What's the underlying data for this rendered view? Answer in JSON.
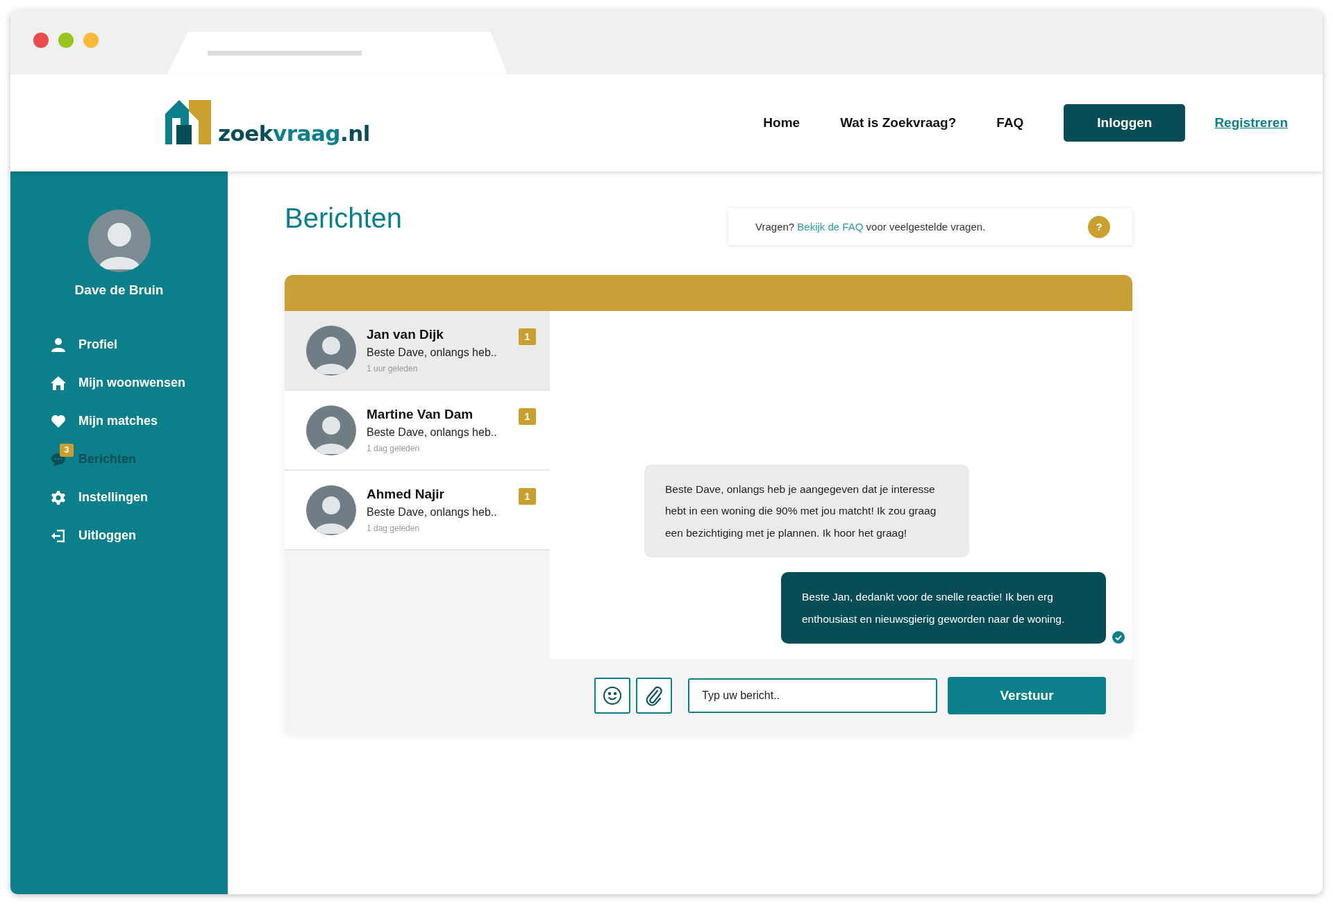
{
  "header": {
    "logo": {
      "part_1": "zoek",
      "part_2": "vraag",
      "part_3": ".nl"
    },
    "nav": [
      {
        "label": "Home",
        "kind": "link"
      },
      {
        "label": "Wat is Zoekvraag?",
        "kind": "link"
      },
      {
        "label": "FAQ",
        "kind": "link"
      },
      {
        "label": "Inloggen",
        "kind": "button"
      },
      {
        "label": "Registreren",
        "kind": "underlined"
      }
    ]
  },
  "sidebar": {
    "user_name": "Dave de Bruin",
    "items": [
      {
        "label": "Profiel",
        "selected": false
      },
      {
        "label": "Mijn woonwensen",
        "selected": false
      },
      {
        "label": "Mijn matches",
        "selected": false
      },
      {
        "label": "Berichten",
        "selected": true,
        "badge": "3"
      },
      {
        "label": "Instellingen",
        "selected": false
      },
      {
        "label": "Uitloggen",
        "selected": false
      }
    ]
  },
  "page_title": "Berichten",
  "faq_notice": {
    "text_before": "Vragen?",
    "link": "Bekijk de FAQ",
    "text_after": "voor veelgestelde vragen.",
    "help": "?"
  },
  "conversations": [
    {
      "name": "Jan van Dijk",
      "preview": "Beste Dave, onlangs heb..",
      "time": "1 uur geleden",
      "unread": "1",
      "selected": true
    },
    {
      "name": "Martine Van Dam",
      "preview": "Beste Dave, onlangs heb..",
      "time": "1 dag geleden",
      "unread": "1",
      "selected": false
    },
    {
      "name": "Ahmed Najir",
      "preview": "Beste Dave, onlangs heb..",
      "time": "1 dag geleden",
      "unread": "1",
      "selected": false
    }
  ],
  "messages": [
    {
      "kind": "incoming",
      "text": "Beste Dave, onlangs heb je aangegeven dat je interesse hebt in een woning die 90% met jou matcht! Ik zou graag een bezichtiging met je plannen. Ik hoor het graag!",
      "read": false
    },
    {
      "kind": "outgoing",
      "text": "Beste Jan, dedankt voor de snelle reactie! Ik ben erg enthousiast en nieuwsgierig geworden naar de woning.",
      "read": true
    }
  ],
  "composer": {
    "placeholder": "Typ uw bericht..",
    "send": "Verstuur"
  }
}
